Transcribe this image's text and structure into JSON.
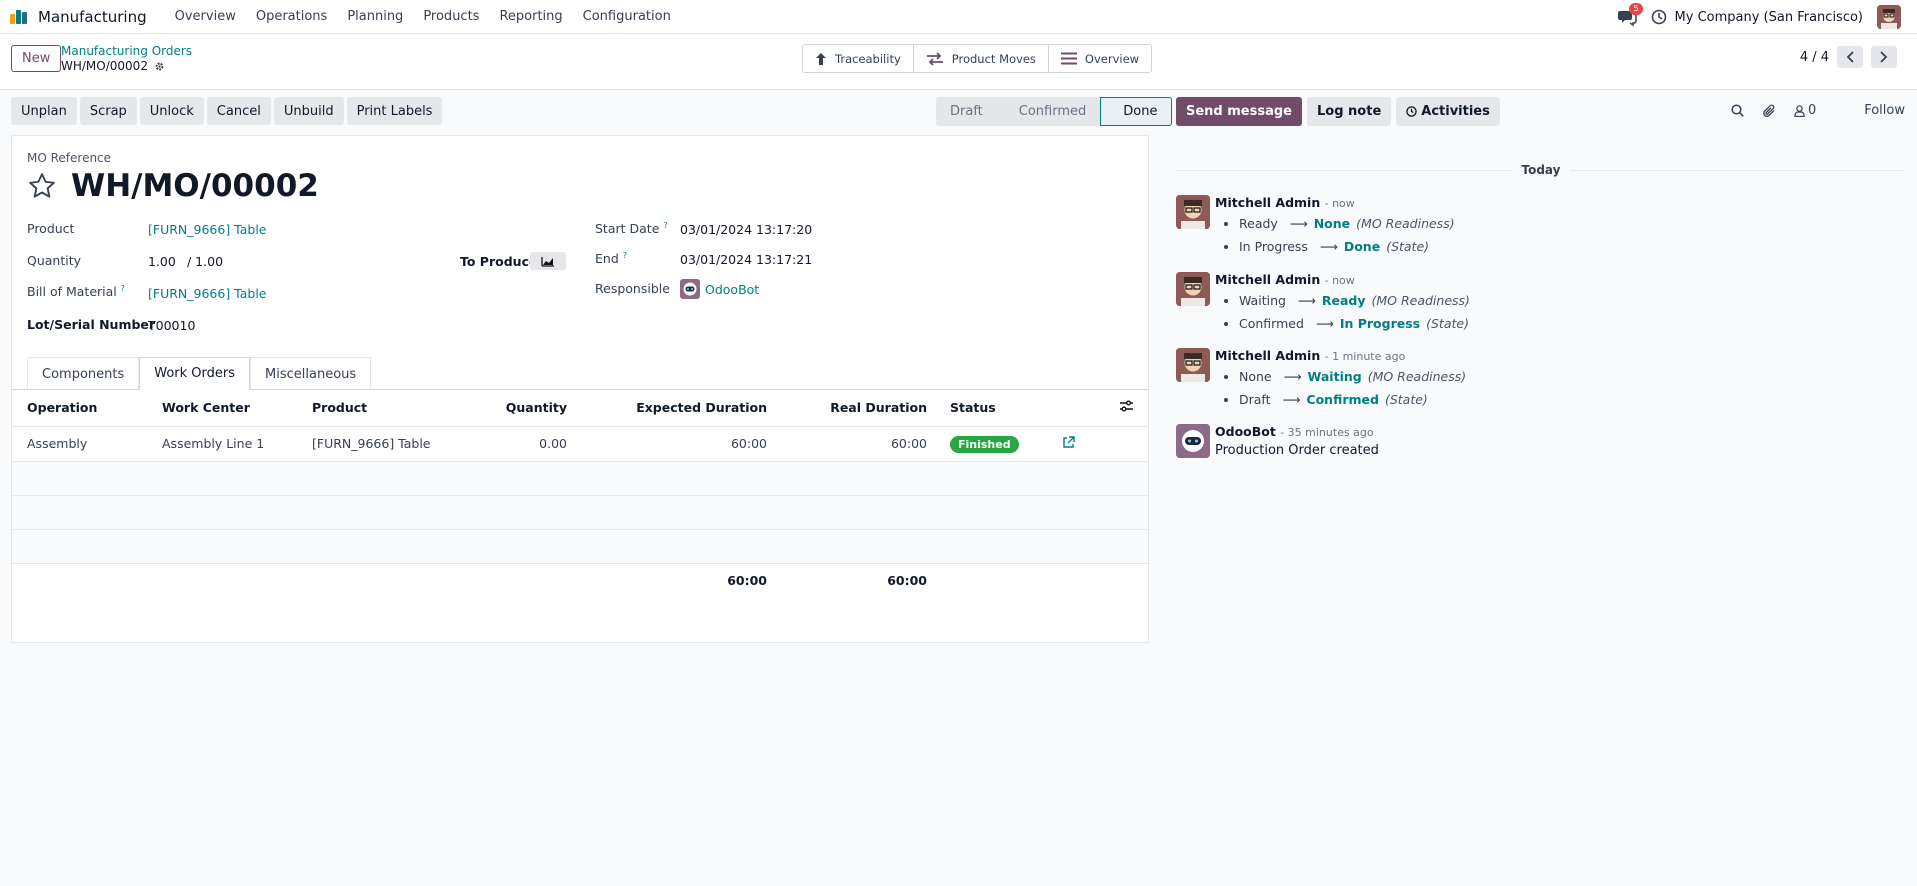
{
  "nav": {
    "app_name": "Manufacturing",
    "menu": [
      "Overview",
      "Operations",
      "Planning",
      "Products",
      "Reporting",
      "Configuration"
    ],
    "chat_badge": "5",
    "company": "My Company (San Francisco)"
  },
  "control": {
    "new_label": "New",
    "breadcrumb_parent": "Manufacturing Orders",
    "breadcrumb_current": "WH/MO/00002",
    "smart_buttons": [
      "Traceability",
      "Product Moves",
      "Overview"
    ],
    "pager": "4 / 4"
  },
  "actions": [
    "Unplan",
    "Scrap",
    "Unlock",
    "Cancel",
    "Unbuild",
    "Print Labels"
  ],
  "stages": [
    "Draft",
    "Confirmed",
    "Done"
  ],
  "form": {
    "ref_label": "MO Reference",
    "ref": "WH/MO/00002",
    "product_label": "Product",
    "product": "[FURN_9666] Table",
    "quantity_label": "Quantity",
    "quantity": "1.00",
    "quantity_total": "/ 1.00",
    "to_produce_label": "To Produce",
    "bom_label": "Bill of Material",
    "bom": "[FURN_9666] Table",
    "lot_label": "Lot/Serial Number",
    "lot": "T00010",
    "start_label": "Start Date",
    "start": "03/01/2024 13:17:20",
    "end_label": "End",
    "end": "03/01/2024 13:17:21",
    "responsible_label": "Responsible",
    "responsible": "OdooBot",
    "help_mark": "?"
  },
  "tabs": [
    "Components",
    "Work Orders",
    "Miscellaneous"
  ],
  "table": {
    "headers": [
      "Operation",
      "Work Center",
      "Product",
      "Quantity",
      "Expected Duration",
      "Real Duration",
      "Status"
    ],
    "row": {
      "operation": "Assembly",
      "work_center": "Assembly Line 1",
      "product": "[FURN_9666] Table",
      "quantity": "0.00",
      "expected": "60:00",
      "real": "60:00",
      "status": "Finished"
    },
    "totals": {
      "expected": "60:00",
      "real": "60:00"
    }
  },
  "chatter": {
    "send_message": "Send message",
    "log_note": "Log note",
    "activities": "Activities",
    "followers": "0",
    "follow": "Follow",
    "today": "Today",
    "messages": [
      {
        "author": "Mitchell Admin",
        "when": "- now",
        "changes": [
          {
            "old": "Ready",
            "new": "None",
            "field": "(MO Readiness)"
          },
          {
            "old": "In Progress",
            "new": "Done",
            "field": "(State)"
          }
        ]
      },
      {
        "author": "Mitchell Admin",
        "when": "- now",
        "changes": [
          {
            "old": "Waiting",
            "new": "Ready",
            "field": "(MO Readiness)"
          },
          {
            "old": "Confirmed",
            "new": "In Progress",
            "field": "(State)"
          }
        ]
      },
      {
        "author": "Mitchell Admin",
        "when": "- 1 minute ago",
        "changes": [
          {
            "old": "None",
            "new": "Waiting",
            "field": "(MO Readiness)"
          },
          {
            "old": "Draft",
            "new": "Confirmed",
            "field": "(State)"
          }
        ]
      },
      {
        "author": "OdooBot",
        "when": "- 35 minutes ago",
        "body": "Production Order created"
      }
    ]
  },
  "colors": {
    "brand": "#714b67",
    "link": "#017e84",
    "success": "#28a745",
    "badge": "#e4464c"
  }
}
